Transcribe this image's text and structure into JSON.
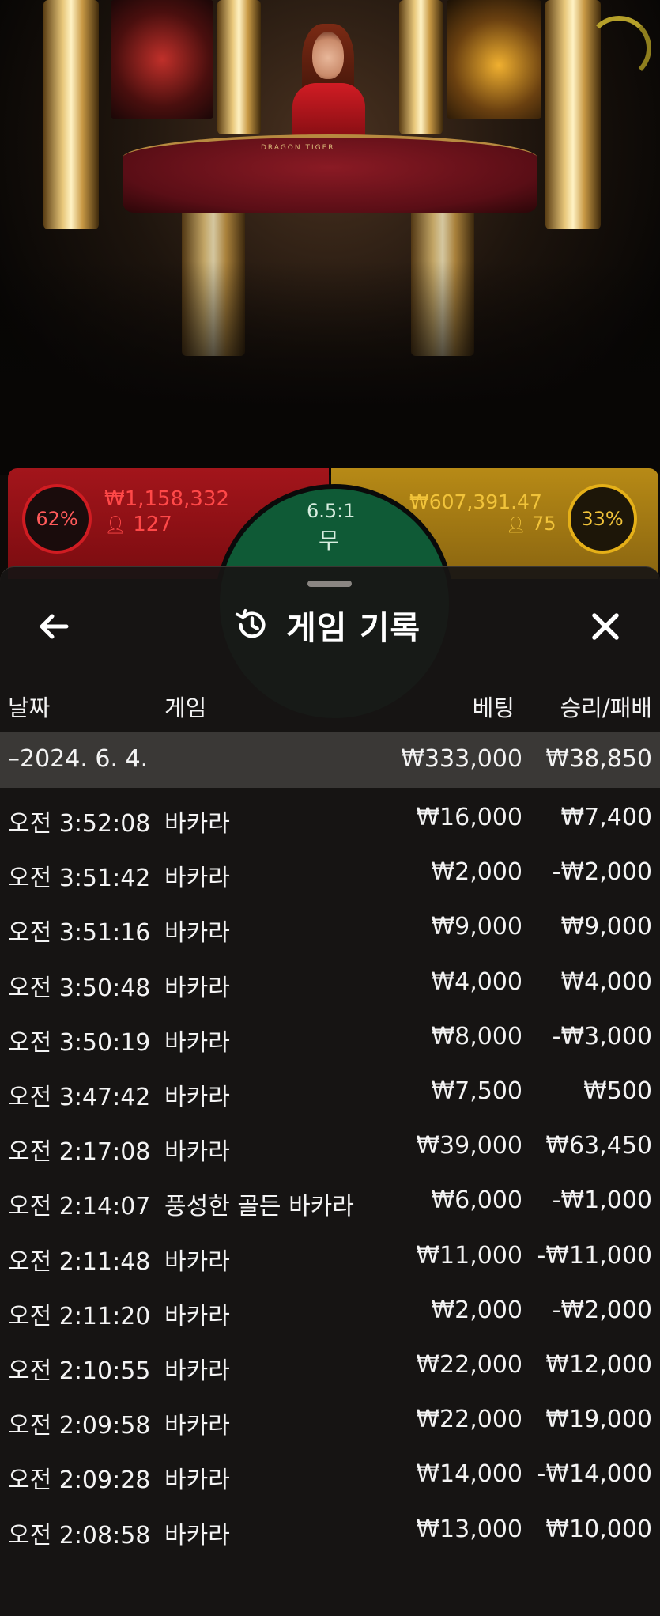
{
  "live_scene": {
    "table_label": "DRAGON TIGER",
    "red": {
      "percent": "62%",
      "amount": "₩1,158,332",
      "players": "127"
    },
    "tie": {
      "odds": "6.5:1",
      "label": "무"
    },
    "yellow": {
      "percent": "33%",
      "amount": "₩607,391.47",
      "players": "75"
    }
  },
  "sheet": {
    "title": "게임 기록",
    "icons": [
      "back-arrow-icon",
      "history-icon",
      "close-icon"
    ],
    "columns": {
      "date": "날짜",
      "game": "게임",
      "bet": "베팅",
      "win_loss": "승리/패배"
    },
    "summary": {
      "date": "–2024. 6. 4.",
      "bet": "₩333,000",
      "win_loss": "₩38,850"
    },
    "rows": [
      {
        "time": "오전 3:52:08",
        "game": "바카라",
        "bet": "₩16,000",
        "win_loss": "₩7,400"
      },
      {
        "time": "오전 3:51:42",
        "game": "바카라",
        "bet": "₩2,000",
        "win_loss": "-₩2,000"
      },
      {
        "time": "오전 3:51:16",
        "game": "바카라",
        "bet": "₩9,000",
        "win_loss": "₩9,000"
      },
      {
        "time": "오전 3:50:48",
        "game": "바카라",
        "bet": "₩4,000",
        "win_loss": "₩4,000"
      },
      {
        "time": "오전 3:50:19",
        "game": "바카라",
        "bet": "₩8,000",
        "win_loss": "-₩3,000"
      },
      {
        "time": "오전 3:47:42",
        "game": "바카라",
        "bet": "₩7,500",
        "win_loss": "₩500"
      },
      {
        "time": "오전 2:17:08",
        "game": "바카라",
        "bet": "₩39,000",
        "win_loss": "₩63,450"
      },
      {
        "time": "오전 2:14:07",
        "game": "풍성한 골든 바카라",
        "bet": "₩6,000",
        "win_loss": "-₩1,000"
      },
      {
        "time": "오전 2:11:48",
        "game": "바카라",
        "bet": "₩11,000",
        "win_loss": "-₩11,000"
      },
      {
        "time": "오전 2:11:20",
        "game": "바카라",
        "bet": "₩2,000",
        "win_loss": "-₩2,000"
      },
      {
        "time": "오전 2:10:55",
        "game": "바카라",
        "bet": "₩22,000",
        "win_loss": "₩12,000"
      },
      {
        "time": "오전 2:09:58",
        "game": "바카라",
        "bet": "₩22,000",
        "win_loss": "₩19,000"
      },
      {
        "time": "오전 2:09:28",
        "game": "바카라",
        "bet": "₩14,000",
        "win_loss": "-₩14,000"
      },
      {
        "time": "오전 2:08:58",
        "game": "바카라",
        "bet": "₩13,000",
        "win_loss": "₩10,000"
      }
    ]
  }
}
